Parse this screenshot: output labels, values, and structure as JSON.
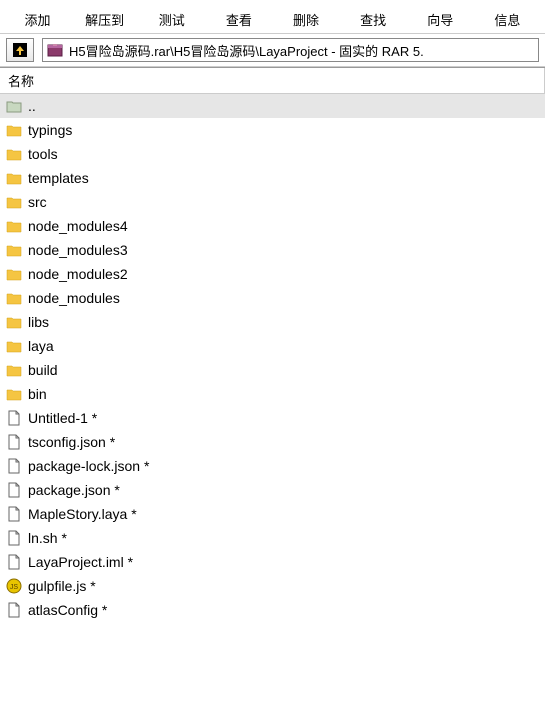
{
  "toolbar": {
    "items": [
      {
        "label": "添加",
        "icon": "add-icon"
      },
      {
        "label": "解压到",
        "icon": "extract-icon"
      },
      {
        "label": "测试",
        "icon": "test-icon"
      },
      {
        "label": "查看",
        "icon": "view-icon"
      },
      {
        "label": "删除",
        "icon": "delete-icon"
      },
      {
        "label": "查找",
        "icon": "find-icon"
      },
      {
        "label": "向导",
        "icon": "wizard-icon"
      },
      {
        "label": "信息",
        "icon": "info-icon"
      }
    ]
  },
  "path": "H5冒险岛源码.rar\\H5冒险岛源码\\LayaProject - 固实的 RAR 5.",
  "column_header": "名称",
  "files": [
    {
      "name": "..",
      "type": "up"
    },
    {
      "name": "typings",
      "type": "folder"
    },
    {
      "name": "tools",
      "type": "folder"
    },
    {
      "name": "templates",
      "type": "folder"
    },
    {
      "name": "src",
      "type": "folder"
    },
    {
      "name": "node_modules4",
      "type": "folder"
    },
    {
      "name": "node_modules3",
      "type": "folder"
    },
    {
      "name": "node_modules2",
      "type": "folder"
    },
    {
      "name": "node_modules",
      "type": "folder"
    },
    {
      "name": "libs",
      "type": "folder"
    },
    {
      "name": "laya",
      "type": "folder"
    },
    {
      "name": "build",
      "type": "folder"
    },
    {
      "name": "bin",
      "type": "folder"
    },
    {
      "name": "Untitled-1 *",
      "type": "file"
    },
    {
      "name": "tsconfig.json *",
      "type": "file"
    },
    {
      "name": "package-lock.json *",
      "type": "file"
    },
    {
      "name": "package.json *",
      "type": "file"
    },
    {
      "name": "MapleStory.laya *",
      "type": "file"
    },
    {
      "name": "ln.sh *",
      "type": "file"
    },
    {
      "name": "LayaProject.iml *",
      "type": "file"
    },
    {
      "name": "gulpfile.js *",
      "type": "js"
    },
    {
      "name": "atlasConfig *",
      "type": "file"
    }
  ]
}
